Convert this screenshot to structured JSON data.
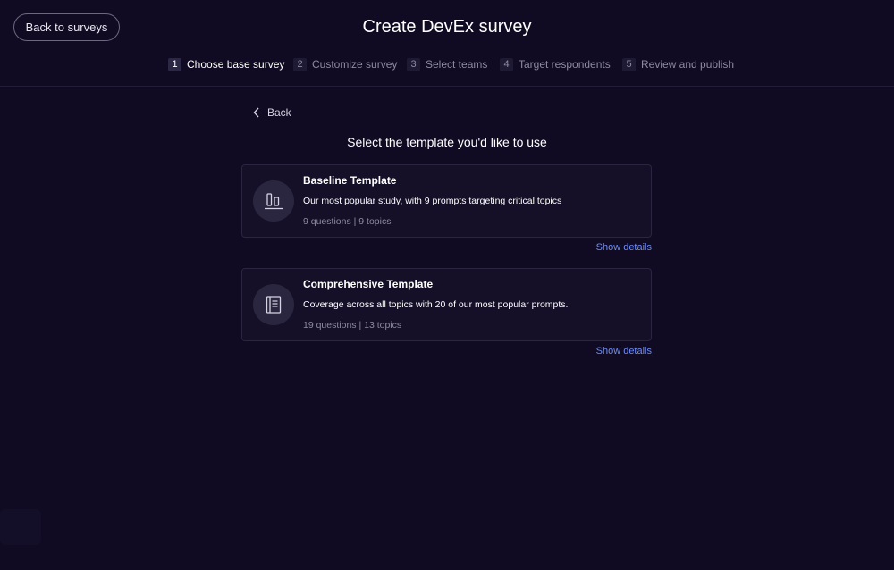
{
  "header": {
    "back_button_label": "Back to surveys",
    "title": "Create DevEx survey"
  },
  "stepper": {
    "steps": [
      {
        "number": "1",
        "label": "Choose base survey",
        "active": true
      },
      {
        "number": "2",
        "label": "Customize survey",
        "active": false
      },
      {
        "number": "3",
        "label": "Select teams",
        "active": false
      },
      {
        "number": "4",
        "label": "Target respondents",
        "active": false
      },
      {
        "number": "5",
        "label": "Review and publish",
        "active": false
      }
    ]
  },
  "main": {
    "back_label": "Back",
    "heading": "Select the template you'd like to use",
    "templates": [
      {
        "title": "Baseline Template",
        "description": "Our most popular study, with 9 prompts targeting critical topics",
        "meta": "9 questions | 9 topics",
        "icon": "bar-chart-icon",
        "details_label": "Show details"
      },
      {
        "title": "Comprehensive Template",
        "description": "Coverage across all topics with 20 of our most popular prompts.",
        "meta": "19 questions | 13 topics",
        "icon": "book-icon",
        "details_label": "Show details"
      }
    ]
  },
  "colors": {
    "background": "#100b22",
    "card_background": "#151027",
    "link": "#6e8cf5",
    "muted_text": "#8e8aa3"
  }
}
